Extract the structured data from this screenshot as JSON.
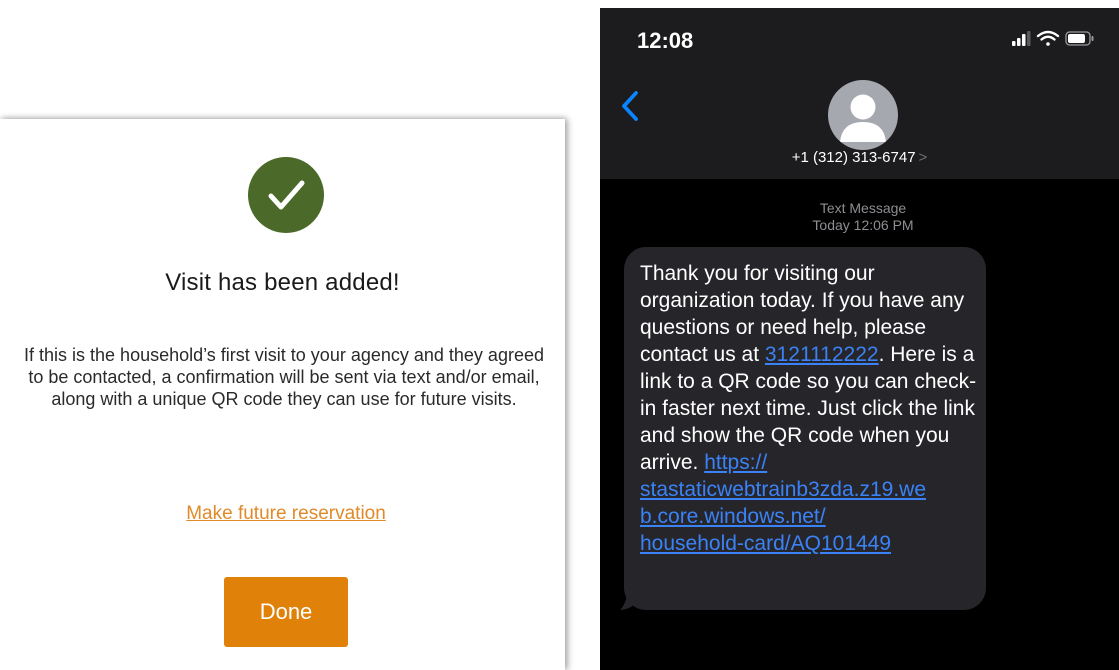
{
  "modal": {
    "title": "Visit has been added!",
    "message": "If this is the household’s first visit to your agency and they agreed to be contacted, a confirmation will be sent via text and/or email, along with a unique QR code they can use for future visits.",
    "future_link_label": "Make future reservation",
    "done_label": "Done",
    "icon": "check-circle-icon",
    "colors": {
      "success": "#4b6a2a",
      "accent": "#e08209",
      "link": "#e08a2a"
    }
  },
  "phone": {
    "time": "12:08",
    "status_icons": [
      "cellular-signal-icon",
      "wifi-icon",
      "battery-icon"
    ],
    "contact_number": "+1 (312) 313-6747",
    "contact_chevron": ">",
    "message_type": "Text Message",
    "message_time": "Today 12:06 PM",
    "sms": {
      "part1": "Thank you for visiting our organization today. If you have any questions or need help, please contact us at ",
      "phone_link": "3121112222",
      "part2": ". Here is a link to a QR code so you can check-in faster next time. Just click the link and show the QR code when you arrive. ",
      "url_line1": "https://",
      "url_line2": "stastaticwebtrainb3zda.z19.we",
      "url_line3": "b.core.windows.net/",
      "url_line4": "household-card/AQ101449"
    },
    "colors": {
      "background": "#000000",
      "bubble": "#26262a",
      "link": "#3b82f6",
      "back": "#0a84ff"
    }
  }
}
